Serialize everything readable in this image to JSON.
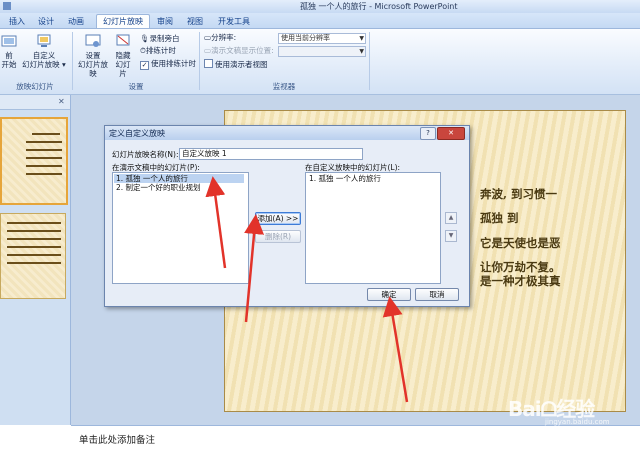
{
  "window": {
    "title": "孤独 一个人的旅行 - Microsoft PowerPoint"
  },
  "tabs": [
    "插入",
    "设计",
    "动画",
    "幻灯片放映",
    "审阅",
    "视图",
    "开发工具"
  ],
  "ribbon": {
    "group1": {
      "btn1_line1": "前",
      "btn1_line2": "开始",
      "btn2_line1": "自定义",
      "btn2_line2": "幻灯片放映 ▾",
      "label": "放映幻灯片"
    },
    "group2": {
      "btn_setup_line1": "设置",
      "btn_setup_line2": "幻灯片放映",
      "btn_hide_line1": "隐藏",
      "btn_hide_line2": "幻灯片",
      "record": "录制旁白",
      "rehearse": "排练计时",
      "use_timings": "使用排练计时",
      "label": "设置"
    },
    "group3": {
      "resolution_label": "分辨率:",
      "resolution_value": "使用当前分辨率",
      "show_on_label": "演示文稿显示位置:",
      "show_on_value": "",
      "presenter_view": "使用演示者视图",
      "label": "监视器"
    }
  },
  "slide_text": [
    "奔波, 到习惯一",
    "孤独        到",
    "它是天使也是恶",
    "让你万劫不复。",
    "是一种才极其真"
  ],
  "notes": {
    "placeholder": "单击此处添加备注"
  },
  "dialog": {
    "title": "定义自定义放映",
    "help": "?",
    "close": "✕",
    "name_label": "幻灯片放映名称(N):",
    "name_value": "自定义放映 1",
    "left_label": "在演示文稿中的幻灯片(P):",
    "left_items": [
      "1. 孤独 一个人的旅行",
      "2. 制定一个好的职业规划"
    ],
    "right_label": "在自定义放映中的幻灯片(L):",
    "right_items": [
      "1. 孤独 一个人的旅行"
    ],
    "add_button": "添加(A) >>",
    "remove_button": "删除(R)",
    "ok_button": "确定",
    "cancel_button": "取消",
    "up_icon": "▲",
    "down_icon": "▼"
  },
  "watermark": {
    "text": "Baiᗝ经验",
    "sub": "jingyan.baidu.com"
  },
  "colors": {
    "ribbon_bg": "#e2ecf9",
    "dialog_bg": "#e7edf7",
    "arrow": "#e2332a",
    "slide_text": "#4a3a12"
  }
}
